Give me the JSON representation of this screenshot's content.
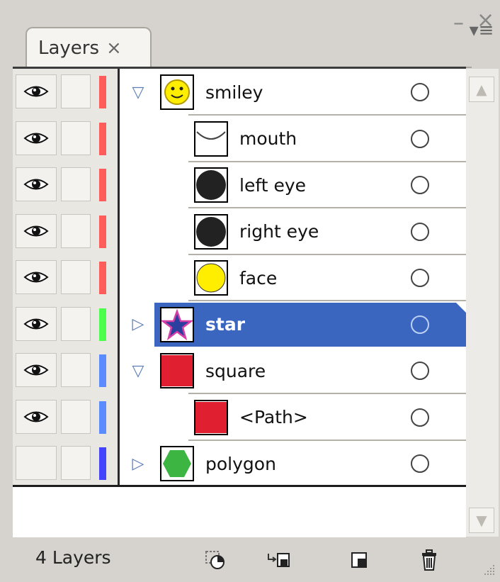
{
  "window": {
    "minimize_glyph": "–",
    "close_glyph": "×"
  },
  "tab": {
    "label": "Layers",
    "close_glyph": "×"
  },
  "panel_menu_glyph": "▾≡",
  "layers": [
    {
      "name": "smiley",
      "level": 0,
      "expanded": true,
      "color": "#ff5c5c",
      "visible": true,
      "thumb": "smiley"
    },
    {
      "name": "mouth",
      "level": 1,
      "color": "#ff5c5c",
      "visible": true,
      "thumb": "mouth"
    },
    {
      "name": "left eye",
      "level": 1,
      "color": "#ff5c5c",
      "visible": true,
      "thumb": "eye"
    },
    {
      "name": "right eye",
      "level": 1,
      "color": "#ff5c5c",
      "visible": true,
      "thumb": "eye"
    },
    {
      "name": "face",
      "level": 1,
      "color": "#ff5c5c",
      "visible": true,
      "thumb": "face"
    },
    {
      "name": "star",
      "level": 0,
      "expanded": false,
      "color": "#4dff4d",
      "visible": true,
      "thumb": "star",
      "selected": true
    },
    {
      "name": "square",
      "level": 0,
      "expanded": true,
      "color": "#5a8cff",
      "visible": true,
      "thumb": "square"
    },
    {
      "name": "<Path>",
      "level": 1,
      "color": "#5a8cff",
      "visible": true,
      "thumb": "square"
    },
    {
      "name": "polygon",
      "level": 0,
      "expanded": false,
      "color": "#4444ff",
      "visible": false,
      "thumb": "polygon"
    }
  ],
  "footer": {
    "count_label": "4 Layers",
    "buttons": [
      {
        "icon": "make-clipping-mask-icon"
      },
      {
        "icon": "create-sublayer-icon"
      },
      {
        "icon": "new-layer-icon"
      },
      {
        "icon": "trash-icon"
      }
    ]
  }
}
